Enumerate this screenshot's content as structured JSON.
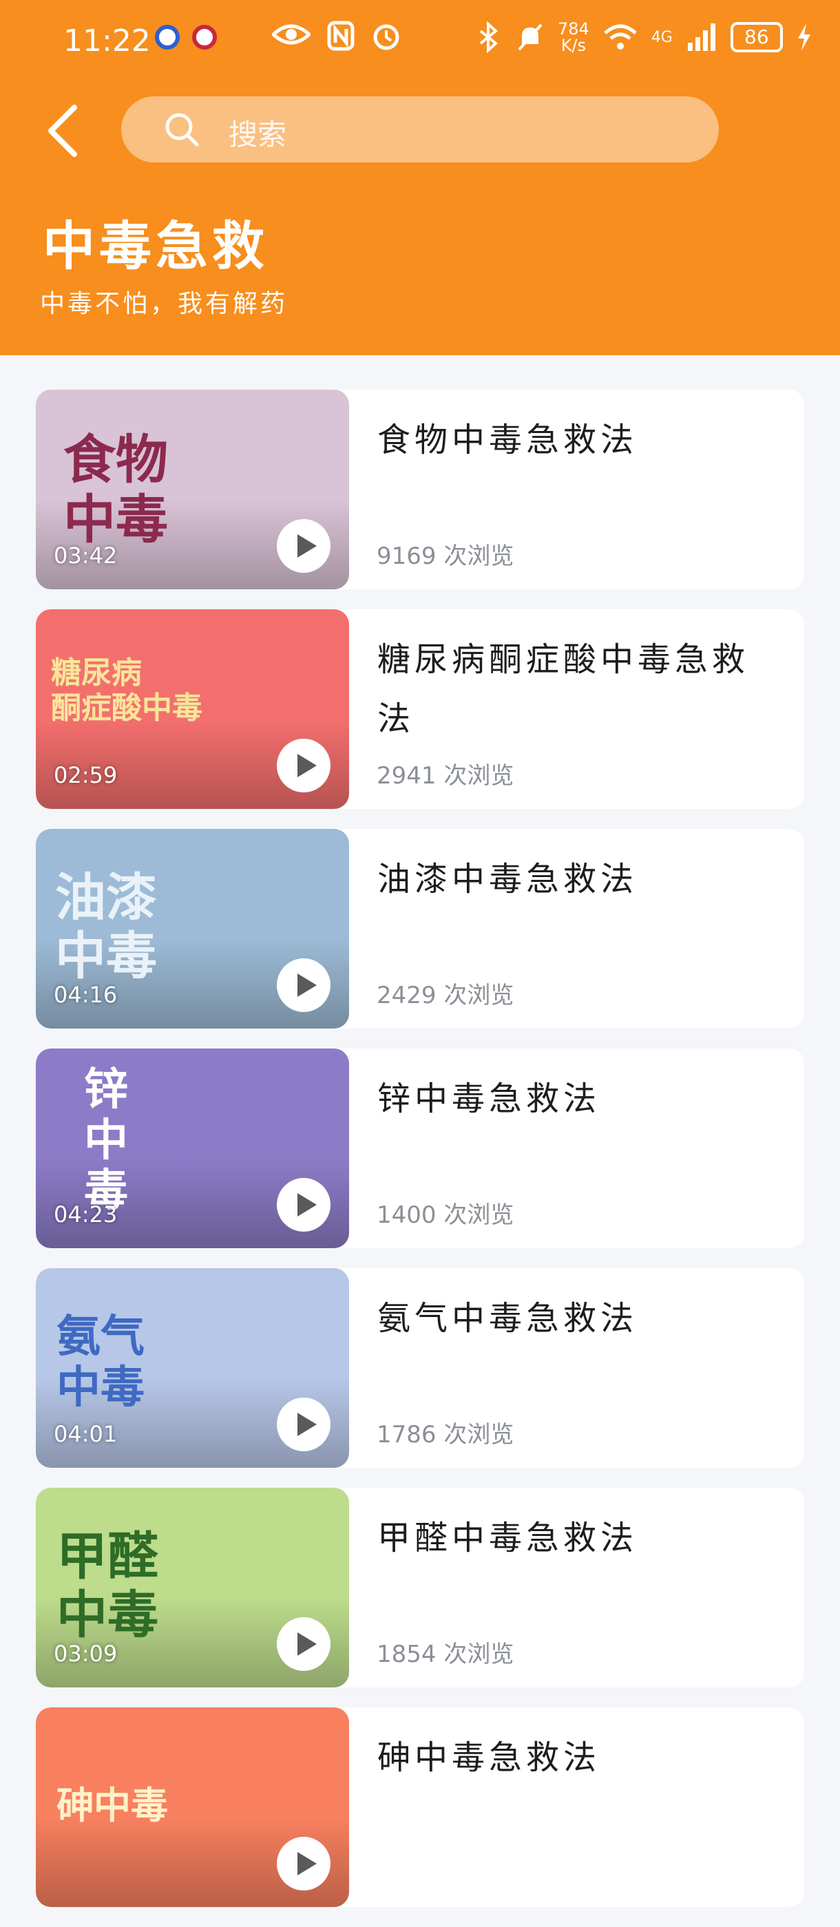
{
  "status_bar": {
    "time": "11:22",
    "speed_top": "784",
    "speed_bottom": "K/s",
    "network": "4G",
    "battery": "86"
  },
  "header": {
    "search_placeholder": "搜索",
    "title": "中毒急救",
    "subtitle": "中毒不怕，我有解药"
  },
  "items": [
    {
      "thumb_text": "食物\n中毒",
      "duration": "03:42",
      "title": "食物中毒急救法",
      "views": "9169 次浏览",
      "bg": "#d9c3d6",
      "text_color": "#8c2a4e"
    },
    {
      "thumb_text": "糖尿病\n酮症酸中毒",
      "duration": "02:59",
      "title": "糖尿病酮症酸中毒急救法",
      "views": "2941 次浏览",
      "bg": "#f36f6d",
      "text_color": "#f9e59a"
    },
    {
      "thumb_text": "油漆\n中毒",
      "duration": "04:16",
      "title": "油漆中毒急救法",
      "views": "2429 次浏览",
      "bg": "#9dbbd6",
      "text_color": "#e9f2f8"
    },
    {
      "thumb_text": "锌\n中\n毒",
      "duration": "04:23",
      "title": "锌中毒急救法",
      "views": "1400 次浏览",
      "bg": "#8c7cc7",
      "text_color": "#ffffff"
    },
    {
      "thumb_text": "氨气\n中毒",
      "duration": "04:01",
      "title": "氨气中毒急救法",
      "views": "1786 次浏览",
      "bg": "#b7c7e8",
      "text_color": "#3f6ac2"
    },
    {
      "thumb_text": "甲醛\n中毒",
      "duration": "03:09",
      "title": "甲醛中毒急救法",
      "views": "1854 次浏览",
      "bg": "#bddc8c",
      "text_color": "#2e6c27"
    },
    {
      "thumb_text": "砷中毒",
      "duration": "",
      "title": "砷中毒急救法",
      "views": "",
      "bg": "#f8805f",
      "text_color": "#fff2c8"
    }
  ]
}
